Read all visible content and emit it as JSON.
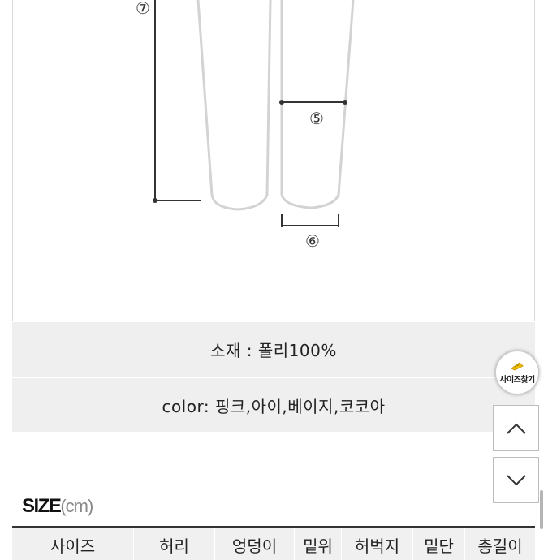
{
  "diagram": {
    "markers": {
      "m5": "⑤",
      "m6": "⑥",
      "m7": "⑦"
    }
  },
  "info": {
    "material": "소재 : 폴리100%",
    "colors": "color: 핑크,아이,베이지,코코아"
  },
  "size_section": {
    "title_bold": "SIZE",
    "title_unit": "(cm)",
    "headers": [
      "사이즈",
      "허리",
      "엉덩이",
      "밑위",
      "허벅지",
      "밑단",
      "총길이"
    ]
  },
  "side_buttons": {
    "finder_label": "사이즈찾기",
    "finder_icon": "tape-measure-icon",
    "up_icon": "chevron-up-icon",
    "down_icon": "chevron-down-icon"
  },
  "colors": {
    "info_bg": "#efefef",
    "finder_accent": "#f2c200"
  }
}
